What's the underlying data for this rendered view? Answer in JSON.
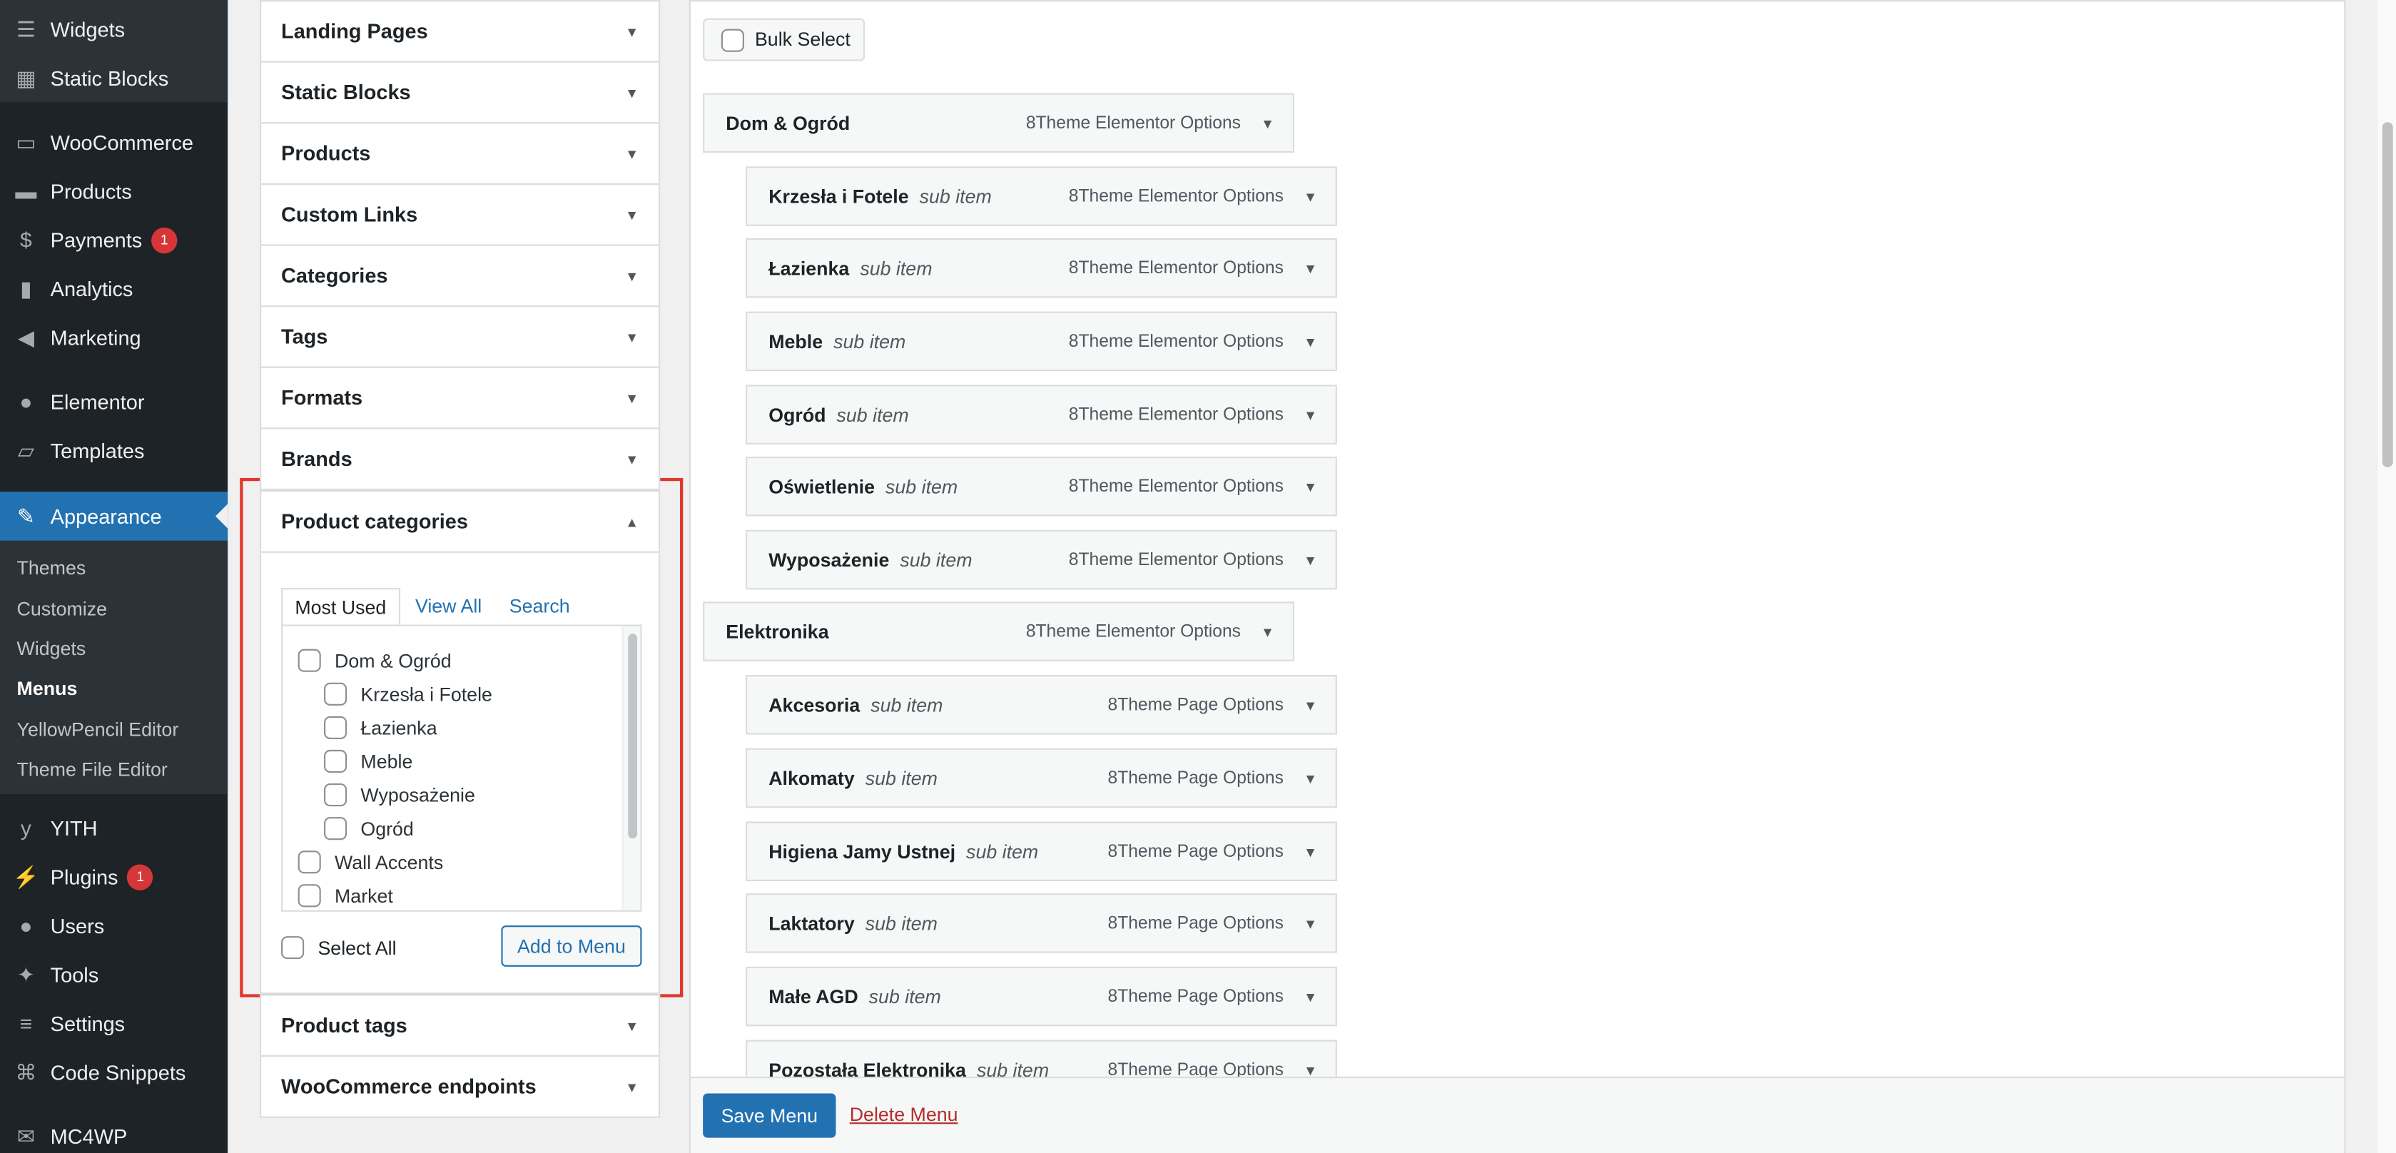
{
  "sidebar": {
    "top_items": [
      {
        "label": "Widgets",
        "icon": "widgets-icon"
      },
      {
        "label": "Static Blocks",
        "icon": "static-blocks-icon"
      }
    ],
    "items": [
      {
        "label": "WooCommerce",
        "icon": "woo-icon"
      },
      {
        "label": "Products",
        "icon": "archive-icon"
      },
      {
        "label": "Payments",
        "icon": "dollar-icon",
        "badge": "1"
      },
      {
        "label": "Analytics",
        "icon": "bar-chart-icon"
      },
      {
        "label": "Marketing",
        "icon": "megaphone-icon"
      },
      {
        "label": "Elementor",
        "icon": "elementor-icon"
      },
      {
        "label": "Templates",
        "icon": "folder-icon"
      },
      {
        "label": "Appearance",
        "icon": "paintbrush-icon"
      },
      {
        "label": "YITH",
        "icon": "yith-icon"
      },
      {
        "label": "Plugins",
        "icon": "plug-icon",
        "badge": "1"
      },
      {
        "label": "Users",
        "icon": "user-icon"
      },
      {
        "label": "Tools",
        "icon": "wrench-icon"
      },
      {
        "label": "Settings",
        "icon": "sliders-icon"
      },
      {
        "label": "Code Snippets",
        "icon": "code-icon"
      },
      {
        "label": "MC4WP",
        "icon": "mail-icon"
      }
    ],
    "submenu": [
      "Themes",
      "Customize",
      "Widgets",
      "Menus",
      "YellowPencil Editor",
      "Theme File Editor"
    ],
    "current_submenu": "Menus"
  },
  "accordion": [
    "Landing Pages",
    "Static Blocks",
    "Products",
    "Custom Links",
    "Categories",
    "Tags",
    "Formats",
    "Brands",
    "Product categories",
    "Product tags",
    "WooCommerce endpoints"
  ],
  "product_categories": {
    "tabs": [
      "Most Used",
      "View All",
      "Search"
    ],
    "items": [
      {
        "label": "Dom & Ogród",
        "level": 0
      },
      {
        "label": "Krzesła i Fotele",
        "level": 1
      },
      {
        "label": "Łazienka",
        "level": 1
      },
      {
        "label": "Meble",
        "level": 1
      },
      {
        "label": "Wyposażenie",
        "level": 1
      },
      {
        "label": "Ogród",
        "level": 1
      },
      {
        "label": "Wall Accents",
        "level": 0
      },
      {
        "label": "Market",
        "level": 0
      }
    ],
    "select_all": "Select All",
    "add_button": "Add to Menu"
  },
  "menu": {
    "bulk_select": "Bulk Select",
    "items": [
      {
        "title": "Dom & Ogród",
        "sub": "",
        "type": "8Theme Elementor Options",
        "depth": 0
      },
      {
        "title": "Krzesła i Fotele",
        "sub": "sub item",
        "type": "8Theme Elementor Options",
        "depth": 1
      },
      {
        "title": "Łazienka",
        "sub": "sub item",
        "type": "8Theme Elementor Options",
        "depth": 1
      },
      {
        "title": "Meble",
        "sub": "sub item",
        "type": "8Theme Elementor Options",
        "depth": 1
      },
      {
        "title": "Ogród",
        "sub": "sub item",
        "type": "8Theme Elementor Options",
        "depth": 1
      },
      {
        "title": "Oświetlenie",
        "sub": "sub item",
        "type": "8Theme Elementor Options",
        "depth": 1
      },
      {
        "title": "Wyposażenie",
        "sub": "sub item",
        "type": "8Theme Elementor Options",
        "depth": 1
      },
      {
        "title": "Elektronika",
        "sub": "",
        "type": "8Theme Elementor Options",
        "depth": 0
      },
      {
        "title": "Akcesoria",
        "sub": "sub item",
        "type": "8Theme Page Options",
        "depth": 1
      },
      {
        "title": "Alkomaty",
        "sub": "sub item",
        "type": "8Theme Page Options",
        "depth": 1
      },
      {
        "title": "Higiena Jamy Ustnej",
        "sub": "sub item",
        "type": "8Theme Page Options",
        "depth": 1
      },
      {
        "title": "Laktatory",
        "sub": "sub item",
        "type": "8Theme Page Options",
        "depth": 1
      },
      {
        "title": "Małe AGD",
        "sub": "sub item",
        "type": "8Theme Page Options",
        "depth": 1
      },
      {
        "title": "Pozostała Elektronika",
        "sub": "sub item",
        "type": "8Theme Page Options",
        "depth": 1
      }
    ],
    "save": "Save Menu",
    "delete": "Delete Menu"
  },
  "colors": {
    "accent": "#2271b1",
    "highlight": "#e0362b",
    "badge": "#d63638"
  }
}
